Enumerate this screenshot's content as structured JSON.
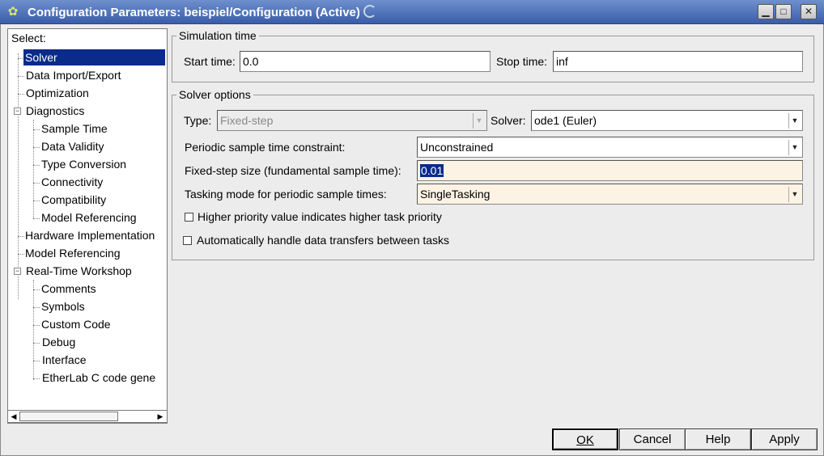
{
  "window": {
    "title": "Configuration Parameters: beispiel/Configuration (Active)",
    "minimize_glyph": "▁",
    "maximize_glyph": "□",
    "close_glyph": "✕",
    "app_icon": "gear-bug-icon"
  },
  "tree": {
    "header": "Select:",
    "items": [
      {
        "label": "Solver",
        "selected": true
      },
      {
        "label": "Data Import/Export"
      },
      {
        "label": "Optimization"
      },
      {
        "label": "Diagnostics",
        "expanded": true
      },
      {
        "label": "Sample Time"
      },
      {
        "label": "Data Validity"
      },
      {
        "label": "Type Conversion"
      },
      {
        "label": "Connectivity"
      },
      {
        "label": "Compatibility"
      },
      {
        "label": "Model Referencing"
      },
      {
        "label": "Hardware Implementation"
      },
      {
        "label": "Model Referencing"
      },
      {
        "label": "Real-Time Workshop",
        "expanded": true
      },
      {
        "label": "Comments"
      },
      {
        "label": "Symbols"
      },
      {
        "label": "Custom Code"
      },
      {
        "label": "Debug"
      },
      {
        "label": "Interface"
      },
      {
        "label": "EtherLab C code gene"
      }
    ],
    "expand_glyph": "−",
    "scroll_left": "◀",
    "scroll_right": "▶"
  },
  "simulation_time": {
    "title": "Simulation time",
    "start_label": "Start time:",
    "start_value": "0.0",
    "stop_label": "Stop time:",
    "stop_value": "inf"
  },
  "solver_options": {
    "title": "Solver options",
    "type_label": "Type:",
    "type_value": "Fixed-step",
    "solver_label": "Solver:",
    "solver_value": "ode1 (Euler)",
    "periodic_label": "Periodic sample time constraint:",
    "periodic_value": "Unconstrained",
    "fixed_step_label": "Fixed-step size (fundamental sample time):",
    "fixed_step_value": "0.01",
    "tasking_label": "Tasking mode for periodic sample times:",
    "tasking_value": "SingleTasking",
    "priority_label": "Higher priority value indicates higher task priority",
    "priority_checked": false,
    "auto_label": "Automatically handle data transfers between tasks",
    "auto_checked": false,
    "dropdown_glyph": "▼"
  },
  "buttons": {
    "ok": "OK",
    "cancel": "Cancel",
    "help": "Help",
    "apply": "Apply"
  },
  "colors": {
    "selection": "#0a2b8a",
    "titlebar": "#4a6db5",
    "highlight_field": "#fcf3e5"
  }
}
